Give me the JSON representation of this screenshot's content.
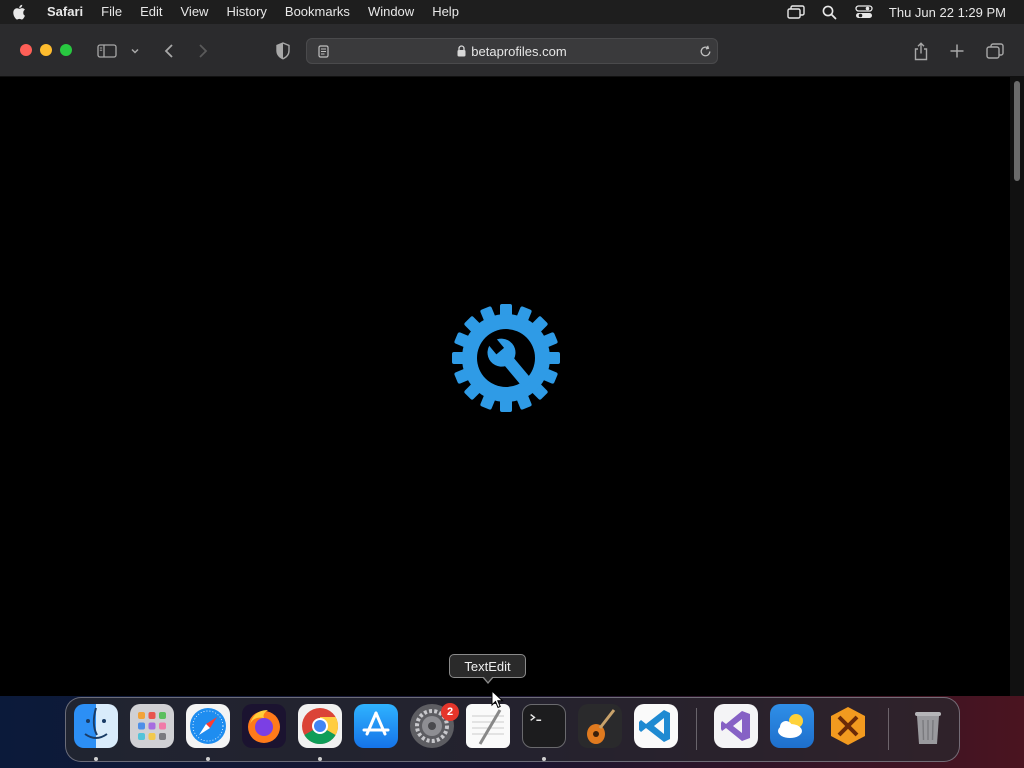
{
  "menubar": {
    "app_name": "Safari",
    "items": [
      "File",
      "Edit",
      "View",
      "History",
      "Bookmarks",
      "Window",
      "Help"
    ],
    "clock": "Thu Jun 22  1:29 PM",
    "status_icons": [
      "screen-mirroring-icon",
      "search-icon",
      "control-center-icon"
    ]
  },
  "toolbar": {
    "url": "betaprofiles.com",
    "secure": true
  },
  "page": {
    "center_icon": "settings-gear-wrench-icon",
    "icon_color": "#2f9be6"
  },
  "tooltip": {
    "text": "TextEdit"
  },
  "dock": {
    "apps": [
      {
        "name": "Finder",
        "icon": "finder-icon",
        "running": true
      },
      {
        "name": "Launchpad",
        "icon": "launchpad-icon",
        "running": false
      },
      {
        "name": "Safari",
        "icon": "safari-icon",
        "running": true
      },
      {
        "name": "Firefox",
        "icon": "firefox-icon",
        "running": false
      },
      {
        "name": "Google Chrome",
        "icon": "chrome-icon",
        "running": true
      },
      {
        "name": "App Store",
        "icon": "app-store-icon",
        "running": false
      },
      {
        "name": "System Settings",
        "icon": "system-settings-icon",
        "running": false,
        "badge": "2"
      },
      {
        "name": "TextEdit",
        "icon": "textedit-icon",
        "running": false
      },
      {
        "name": "Terminal",
        "icon": "terminal-icon",
        "running": true
      },
      {
        "name": "GarageBand",
        "icon": "garageband-icon",
        "running": false
      },
      {
        "name": "Visual Studio Code",
        "icon": "vscode-icon",
        "running": false
      },
      {
        "name": "Visual Studio",
        "icon": "visual-studio-icon",
        "running": false
      },
      {
        "name": "Weather",
        "icon": "weather-icon",
        "running": false
      },
      {
        "name": "CrossOver",
        "icon": "crossover-icon",
        "running": false
      },
      {
        "name": "Trash",
        "icon": "trash-icon",
        "running": false
      }
    ]
  }
}
